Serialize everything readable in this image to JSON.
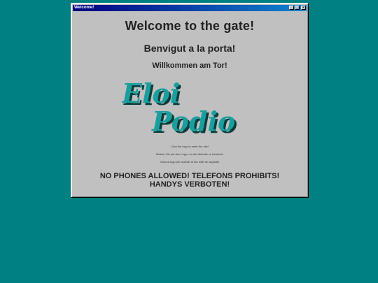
{
  "window": {
    "title": "Welcome!",
    "controls": {
      "minimize_icon": "minimize-icon",
      "maximize_icon": "maximize-icon",
      "close_icon": "close-icon",
      "minimize_glyph": "_",
      "maximize_glyph": "□",
      "close_glyph": "×"
    }
  },
  "content": {
    "heading_en": "Welcome to the gate!",
    "heading_ca": "Benvigut a la porta!",
    "heading_de": "Willkommen am Tor!",
    "logo": {
      "line1": "Eloi",
      "line2": "Podio",
      "color": "#1a9e9e"
    },
    "instructions": {
      "en": "Click the logo to enter the site!",
      "de": "Klicken Sie auf den Logo, um die Website zu betreten!",
      "ca": "Clica al logo per accedir al lloc web de seguida!"
    },
    "notice": "NO PHONES ALLOWED! TELEFONS PROHIBITS! HANDYS VERBOTEN!"
  },
  "colors": {
    "desktop": "#008080",
    "window_face": "#c0c0c0",
    "titlebar": "#000080"
  }
}
